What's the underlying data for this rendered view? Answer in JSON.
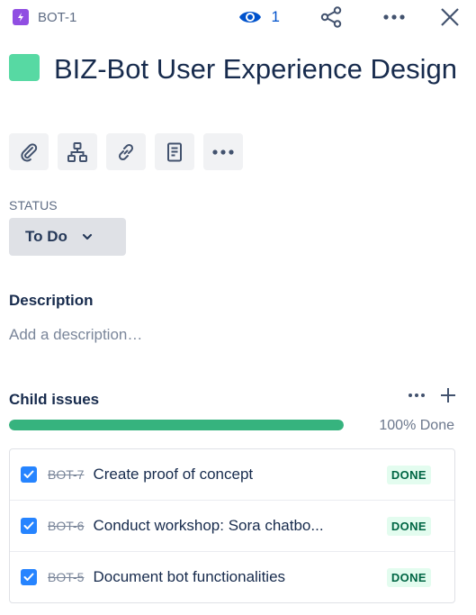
{
  "header": {
    "issue_key": "BOT-1",
    "watch_count": "1",
    "epic_color": "#904ee2",
    "icons": [
      "lightning-icon",
      "eye-icon",
      "share-icon",
      "more-icon",
      "close-icon"
    ]
  },
  "issue": {
    "title": "BIZ-Bot User Experience Design",
    "swatch_color": "#57d9a3"
  },
  "toolbar": {
    "buttons": [
      "attachment-icon",
      "hierarchy-icon",
      "link-icon",
      "page-icon",
      "more-icon"
    ]
  },
  "status": {
    "label": "STATUS",
    "value": "To Do"
  },
  "description": {
    "heading": "Description",
    "placeholder": "Add a description…"
  },
  "child_issues": {
    "heading": "Child issues",
    "progress_percent": 100,
    "progress_text": "100% Done",
    "progress_color": "#36b37e",
    "items": [
      {
        "key": "BOT-7",
        "summary": "Create proof of concept",
        "status": "DONE",
        "checked": true
      },
      {
        "key": "BOT-6",
        "summary": "Conduct workshop: Sora chatbo...",
        "status": "DONE",
        "checked": true
      },
      {
        "key": "BOT-5",
        "summary": "Document bot functionalities",
        "status": "DONE",
        "checked": true
      }
    ]
  }
}
